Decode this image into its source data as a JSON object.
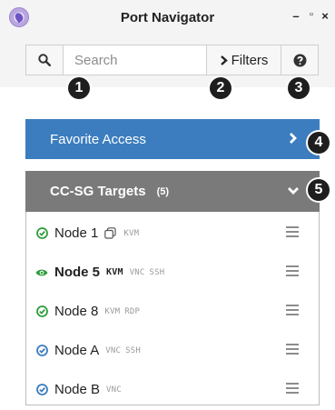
{
  "window": {
    "title": "Port Navigator",
    "controls": {
      "minimize": "–",
      "maximize": "▫",
      "close": "×"
    }
  },
  "toolbar": {
    "search_icon": "search-icon",
    "search_placeholder": "Search",
    "search_value": "",
    "filters_label": "Filters",
    "help_icon": "question-circle-icon"
  },
  "callouts": [
    "1",
    "2",
    "3",
    "4",
    "5"
  ],
  "favorite_access": {
    "label": "Favorite Access",
    "state": "collapsed"
  },
  "targets": {
    "title": "CC-SG Targets",
    "count": "(5)",
    "state": "expanded",
    "rows": [
      {
        "name": "Node 1",
        "status": "available",
        "bold": false,
        "protocols": [
          "KVM"
        ],
        "active_protocol": "",
        "has_multi_icon": true
      },
      {
        "name": "Node 5",
        "status": "in-use",
        "bold": true,
        "protocols": [
          "VNC",
          "SSH"
        ],
        "active_protocol": "KVM",
        "has_multi_icon": false
      },
      {
        "name": "Node 8",
        "status": "available",
        "bold": false,
        "protocols": [
          "KVM",
          "RDP"
        ],
        "active_protocol": "",
        "has_multi_icon": false
      },
      {
        "name": "Node A",
        "status": "available-blue",
        "bold": false,
        "protocols": [
          "VNC",
          "SSH"
        ],
        "active_protocol": "",
        "has_multi_icon": false
      },
      {
        "name": "Node B",
        "status": "available-blue",
        "bold": false,
        "protocols": [
          "VNC"
        ],
        "active_protocol": "",
        "has_multi_icon": false
      }
    ]
  },
  "colors": {
    "favorite_bg": "#3b7dbf",
    "targets_header_bg": "#7a7a7a",
    "status_green": "#2e9d3c",
    "status_blue": "#3b7dbf"
  }
}
